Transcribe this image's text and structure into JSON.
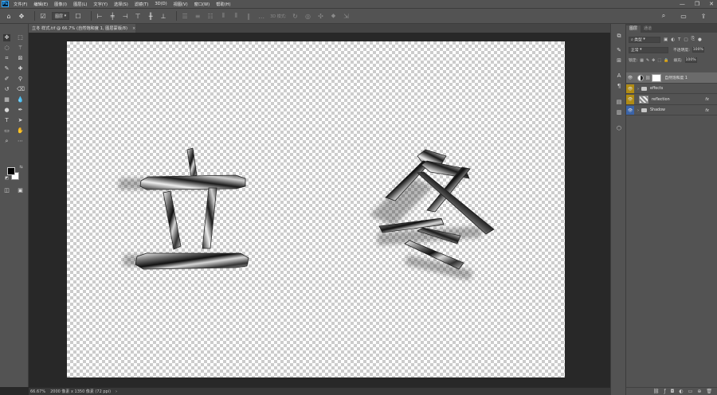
{
  "menubar": {
    "logo": "Ps",
    "items": [
      "文件(F)",
      "编辑(E)",
      "图像(I)",
      "图层(L)",
      "文字(Y)",
      "选择(S)",
      "滤镜(T)",
      "3D(D)",
      "视图(V)",
      "窗口(W)",
      "帮助(H)"
    ],
    "window_controls": [
      "—",
      "❐",
      "✕"
    ]
  },
  "options_bar": {
    "layer_select": "图层",
    "mode_3d": "3D 模式:"
  },
  "document_tab": {
    "title": "立冬 样式.tif @ 66.7% (自然饱和度 1, 图层蒙版/8)",
    "close": "×"
  },
  "status_bar": {
    "zoom": "66.67%",
    "info": "2000 像素 x 1350 像素 (72 ppi)",
    "arrow": "›"
  },
  "layers_panel": {
    "tabs": [
      "图层",
      "通道"
    ],
    "kind_filter": "类型",
    "blend_mode": "正常",
    "opacity_label": "不透明度:",
    "opacity_value": "100%",
    "lock_label": "锁定:",
    "fill_label": "填充:",
    "fill_value": "100%",
    "layers": [
      {
        "name": "自然饱和度 1",
        "fx": ""
      },
      {
        "name": "effects",
        "fx": ""
      },
      {
        "name": "reflection",
        "fx": "fx"
      },
      {
        "name": "Shadow",
        "fx": "fx"
      }
    ]
  },
  "icons": {
    "home": "home-icon",
    "move": "move-tool-icon",
    "search": "search-icon",
    "workspace": "workspace-icon",
    "share": "share-icon"
  }
}
